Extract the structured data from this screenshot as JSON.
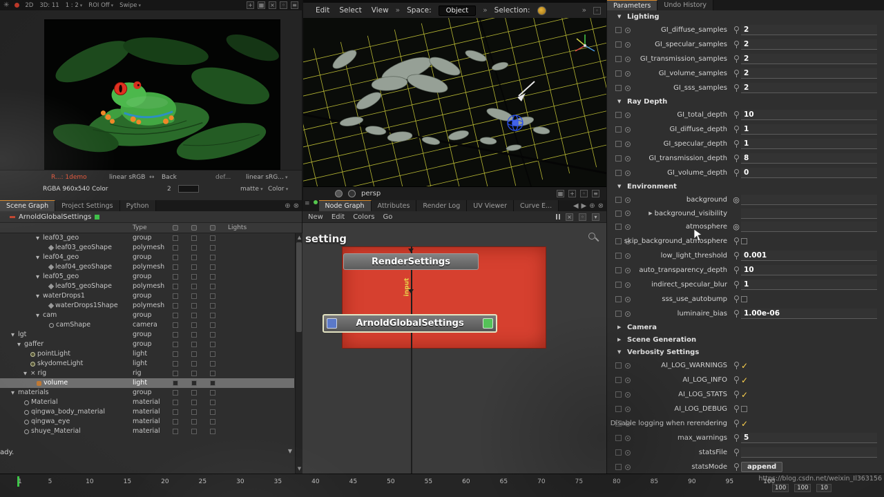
{
  "top_toolbar": {
    "items": [
      {
        "label": "2D"
      },
      {
        "label": "3D: 11"
      },
      {
        "label": "1 : 2",
        "caret": true
      },
      {
        "label": "ROI Off",
        "caret": true
      },
      {
        "label": "Swipe",
        "caret": true
      }
    ]
  },
  "monitor": {
    "info": "R...: 1demo",
    "colorspace1": "linear sRGB",
    "back_label": "Back",
    "def_label": "def...",
    "colorspace2": "linear sRG...",
    "buffer_info": "RGBA 960x540 Color",
    "back_value": "2",
    "matte_label": "matte",
    "color_label": "Color"
  },
  "viewport": {
    "menus": [
      "Edit",
      "Select",
      "View"
    ],
    "space_label": "Space:",
    "space_value": "Object",
    "selection_label": "Selection:",
    "camera_name": "persp"
  },
  "left_tabs": [
    {
      "label": "Scene Graph",
      "active": true
    },
    {
      "label": "Project Settings"
    },
    {
      "label": "Python"
    }
  ],
  "scene_graph": {
    "view_node": "ArnoldGlobalSettings",
    "header": {
      "type": "Type",
      "lights": "Lights"
    },
    "rows": [
      {
        "name": "leaf03_geo",
        "type": "group",
        "depth": 4,
        "exp": true
      },
      {
        "name": "leaf03_geoShape",
        "type": "polymesh",
        "depth": 5,
        "icon": "mesh"
      },
      {
        "name": "leaf04_geo",
        "type": "group",
        "depth": 4,
        "exp": true
      },
      {
        "name": "leaf04_geoShape",
        "type": "polymesh",
        "depth": 5,
        "icon": "mesh"
      },
      {
        "name": "leaf05_geo",
        "type": "group",
        "depth": 4,
        "exp": true
      },
      {
        "name": "leaf05_geoShape",
        "type": "polymesh",
        "depth": 5,
        "icon": "mesh"
      },
      {
        "name": "waterDrops1",
        "type": "group",
        "depth": 4,
        "exp": true
      },
      {
        "name": "waterDrops1Shape",
        "type": "polymesh",
        "depth": 5,
        "icon": "mesh"
      },
      {
        "name": "cam",
        "type": "group",
        "depth": 4,
        "exp": true
      },
      {
        "name": "camShape",
        "type": "camera",
        "depth": 5,
        "icon": "camera"
      },
      {
        "name": "lgt",
        "type": "group",
        "depth": 0,
        "exp": true
      },
      {
        "name": "gaffer",
        "type": "group",
        "depth": 1,
        "exp": true
      },
      {
        "name": "pointLight",
        "type": "light",
        "depth": 2,
        "icon": "light"
      },
      {
        "name": "skydomeLight",
        "type": "light",
        "depth": 2,
        "icon": "light"
      },
      {
        "name": "rig",
        "type": "rig",
        "depth": 2,
        "exp": true,
        "icon": "x"
      },
      {
        "name": "volume",
        "type": "light",
        "depth": 3,
        "icon": "volume",
        "sel": true
      },
      {
        "name": "materials",
        "type": "group",
        "depth": 0,
        "exp": true
      },
      {
        "name": "Material",
        "type": "material",
        "depth": 1,
        "icon": "material"
      },
      {
        "name": "qingwa_body_material",
        "type": "material",
        "depth": 1,
        "icon": "material"
      },
      {
        "name": "qingwa_eye",
        "type": "material",
        "depth": 1,
        "icon": "material"
      },
      {
        "name": "shuye_Material",
        "type": "material",
        "depth": 1,
        "icon": "material"
      }
    ]
  },
  "node_graph": {
    "tabs": [
      {
        "label": "Node Graph",
        "active": true
      },
      {
        "label": "Attributes"
      },
      {
        "label": "Render Log"
      },
      {
        "label": "UV Viewer"
      },
      {
        "label": "Curve E..."
      }
    ],
    "menus": [
      "New",
      "Edit",
      "Colors",
      "Go"
    ],
    "backdrop_text": "setting",
    "node1": "RenderSettings",
    "node2": "ArnoldGlobalSettings",
    "edge_label": "input"
  },
  "parameters": {
    "tabs": [
      {
        "label": "Parameters",
        "active": true
      },
      {
        "label": "Undo History"
      }
    ],
    "rows": [
      {
        "kind": "section",
        "label": "Lighting",
        "expanded": true
      },
      {
        "kind": "number",
        "label": "GI_diffuse_samples",
        "value": "2"
      },
      {
        "kind": "number",
        "label": "GI_specular_samples",
        "value": "2"
      },
      {
        "kind": "number",
        "label": "GI_transmission_samples",
        "value": "2"
      },
      {
        "kind": "number",
        "label": "GI_volume_samples",
        "value": "2"
      },
      {
        "kind": "number",
        "label": "GI_sss_samples",
        "value": "2"
      },
      {
        "kind": "section",
        "label": "Ray Depth",
        "expanded": true
      },
      {
        "kind": "number",
        "label": "GI_total_depth",
        "value": "10"
      },
      {
        "kind": "number",
        "label": "GI_diffuse_depth",
        "value": "1"
      },
      {
        "kind": "number",
        "label": "GI_specular_depth",
        "value": "1"
      },
      {
        "kind": "number",
        "label": "GI_transmission_depth",
        "value": "8"
      },
      {
        "kind": "number",
        "label": "GI_volume_depth",
        "value": "0"
      },
      {
        "kind": "section",
        "label": "Environment",
        "expanded": true
      },
      {
        "kind": "shader",
        "label": "background"
      },
      {
        "kind": "subgroup",
        "label": "background_visibility"
      },
      {
        "kind": "shader",
        "label": "atmosphere"
      },
      {
        "kind": "checkbox",
        "label": "skip_background_atmosphere",
        "checked": false
      },
      {
        "kind": "number",
        "label": "low_light_threshold",
        "value": "0.001"
      },
      {
        "kind": "number",
        "label": "auto_transparency_depth",
        "value": "10"
      },
      {
        "kind": "number",
        "label": "indirect_specular_blur",
        "value": "1"
      },
      {
        "kind": "checkbox",
        "label": "sss_use_autobump",
        "checked": false
      },
      {
        "kind": "number",
        "label": "luminaire_bias",
        "value": "1.00e-06"
      },
      {
        "kind": "section",
        "label": "Camera",
        "expanded": false
      },
      {
        "kind": "section",
        "label": "Scene Generation",
        "expanded": false
      },
      {
        "kind": "section",
        "label": "Verbosity Settings",
        "expanded": true
      },
      {
        "kind": "checkbox",
        "label": "AI_LOG_WARNINGS",
        "checked": true
      },
      {
        "kind": "checkbox",
        "label": "AI_LOG_INFO",
        "checked": true
      },
      {
        "kind": "checkbox",
        "label": "AI_LOG_STATS",
        "checked": true
      },
      {
        "kind": "checkbox",
        "label": "AI_LOG_DEBUG",
        "checked": false
      },
      {
        "kind": "checkbox",
        "label": "Disable logging when rerendering",
        "checked": true
      },
      {
        "kind": "number",
        "label": "max_warnings",
        "value": "5"
      },
      {
        "kind": "text",
        "label": "statsFile",
        "value": ""
      },
      {
        "kind": "dropdown",
        "label": "statsMode",
        "value": "append"
      }
    ]
  },
  "timeline": {
    "ticks": [
      1,
      5,
      10,
      15,
      20,
      25,
      30,
      35,
      40,
      45,
      50,
      55,
      60,
      65,
      70,
      75,
      80,
      85,
      90,
      95,
      100
    ],
    "current_frame": "1",
    "end_fields": [
      "100",
      "100",
      "10"
    ]
  },
  "watermark": "https://blog.csdn.net/weixin_Il363156",
  "status_text": "ady."
}
